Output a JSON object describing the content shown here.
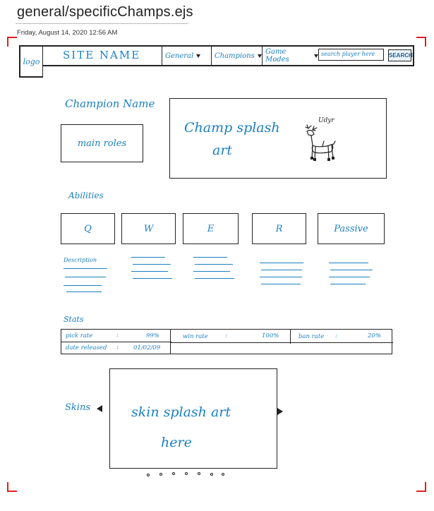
{
  "header": {
    "title": "general/specificChamps.ejs",
    "timestamp": "Friday, August 14, 2020     12:56 AM"
  },
  "nav": {
    "logo": "logo",
    "site_name": "SITE NAME",
    "menus": [
      "General",
      "Champions",
      "Game Modes"
    ],
    "search_placeholder": "search player here",
    "search_button": "SEARCH"
  },
  "champion": {
    "name_label": "Champion Name",
    "main_roles": "main roles",
    "splash_line1": "Champ splash",
    "splash_line2": "art",
    "sketch_caption": "Udyr"
  },
  "abilities": {
    "heading": "Abilities",
    "keys": [
      "Q",
      "W",
      "E",
      "R",
      "Passive"
    ],
    "description_label": "Description"
  },
  "stats": {
    "heading": "Stats",
    "pick_rate_label": "pick rate",
    "pick_rate_value": "99%",
    "date_released_label": "date released",
    "date_released_value": "01/02/09",
    "win_rate_label": "win rate",
    "win_rate_value": "100%",
    "ban_rate_label": "ban rate",
    "ban_rate_value": "20%"
  },
  "skins": {
    "heading": "Skins",
    "splash_line1": "skin splash art",
    "splash_line2": "here",
    "pagination_dots": 7
  },
  "colors": {
    "ink_blue": "#1a7fc1",
    "pen_black": "#222222",
    "margin_red": "#e02020"
  }
}
